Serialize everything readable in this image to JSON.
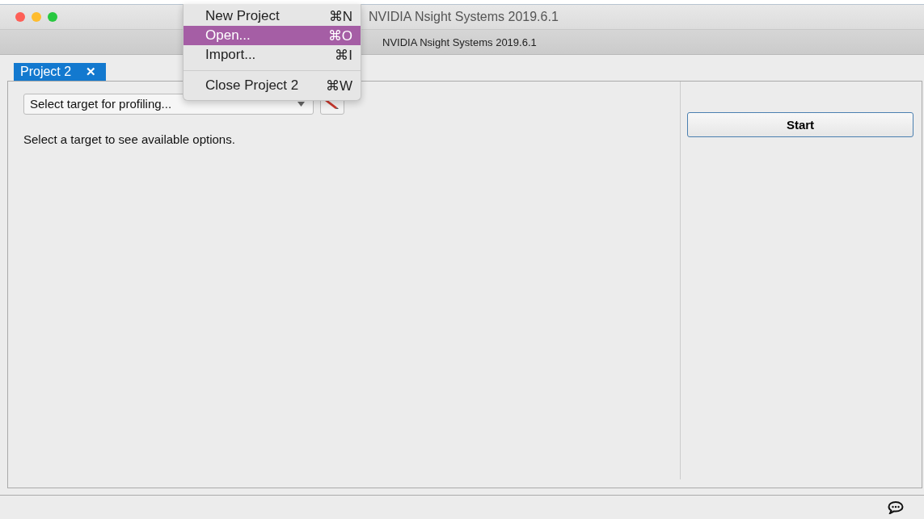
{
  "window": {
    "title": "NVIDIA Nsight Systems 2019.6.1",
    "subtitle": "NVIDIA Nsight Systems 2019.6.1"
  },
  "menu": [
    {
      "kind": "item",
      "label": "New Project",
      "shortcut": "⌘N",
      "selected": false
    },
    {
      "kind": "item",
      "label": "Open...",
      "shortcut": "⌘O",
      "selected": true
    },
    {
      "kind": "item",
      "label": "Import...",
      "shortcut": "⌘I",
      "selected": false
    },
    {
      "kind": "separator"
    },
    {
      "kind": "item",
      "label": "Close Project 2",
      "shortcut": "⌘W",
      "selected": false
    }
  ],
  "tabs": [
    {
      "label": "Project 2",
      "close": "✕",
      "selected": true
    }
  ],
  "target": {
    "value": "Select target for profiling..."
  },
  "message": "Select a target to see available options.",
  "start_button": "Start"
}
